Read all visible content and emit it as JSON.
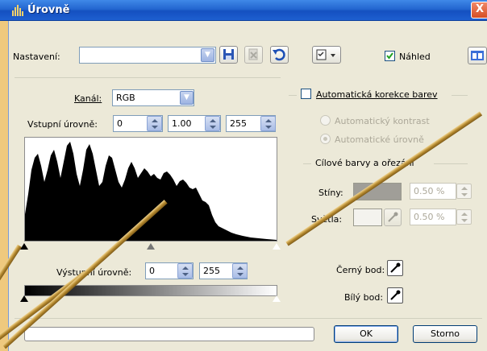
{
  "window": {
    "title": "Úrovně",
    "close_glyph": "X"
  },
  "toolbar": {
    "preset_label": "Nastavení:",
    "preset_value": "",
    "preview_label": "Náhled",
    "preview_checked": true
  },
  "channel": {
    "label": "Kanál:",
    "value": "RGB"
  },
  "input_levels": {
    "label": "Vstupní úrovně:",
    "black": "0",
    "gamma": "1.00",
    "white": "255"
  },
  "output_levels": {
    "label": "Výstupní úrovně:",
    "black": "0",
    "white": "255"
  },
  "auto_correct": {
    "label": "Automatická korekce barev",
    "checked": false,
    "contrast_label": "Automatický kontrast",
    "levels_label": "Automatické úrovně"
  },
  "target_group": {
    "title": "Cílové barvy a ořezání",
    "shadows_label": "Stíny:",
    "shadows_value": "0.50 %",
    "highlights_label": "Světla:",
    "highlights_value": "0.50 %"
  },
  "black_point": {
    "label": "Černý bod:"
  },
  "white_point": {
    "label": "Bílý bod:"
  },
  "buttons": {
    "ok": "OK",
    "cancel": "Storno"
  },
  "progress": {
    "value": 0
  },
  "colors": {
    "titlebar": "#2366d0",
    "dialog_bg": "#ece9d8",
    "outer_bg": "#efc97e",
    "shadow_swatch": "#a09e98"
  }
}
